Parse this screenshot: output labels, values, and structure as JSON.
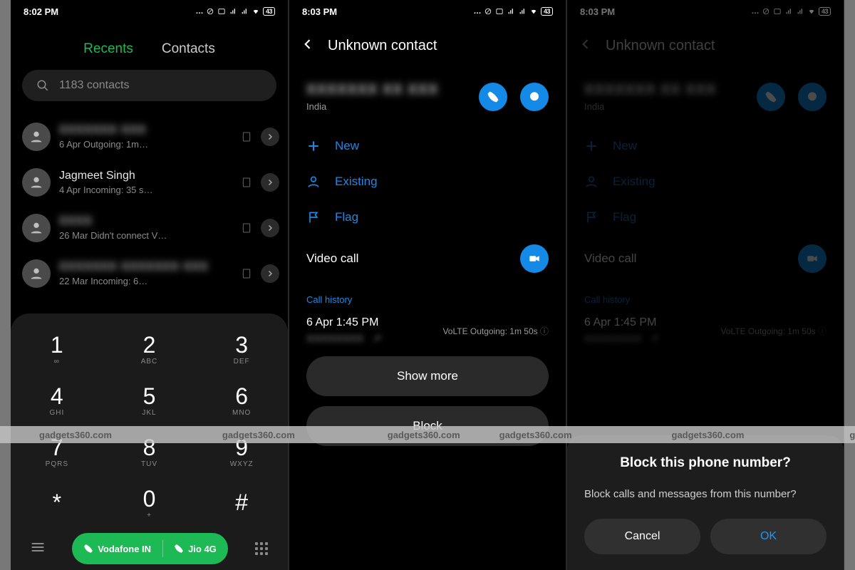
{
  "status": {
    "t1": "8:02 PM",
    "t2": "8:03 PM",
    "t3": "8:03 PM",
    "battery": "43"
  },
  "s1": {
    "tabs": {
      "recents": "Recents",
      "contacts": "Contacts"
    },
    "search": "1183 contacts",
    "rows": [
      {
        "name": "",
        "info": "6 Apr Outgoing: 1m…"
      },
      {
        "name": "Jagmeet Singh",
        "info": "4 Apr Incoming: 35 s…"
      },
      {
        "name": "",
        "info": "26 Mar Didn't connect V…"
      },
      {
        "name": "",
        "info": "22 Mar Incoming: 6…"
      }
    ],
    "dial": {
      "keys": [
        {
          "d": "1",
          "l": "∞"
        },
        {
          "d": "2",
          "l": "ABC"
        },
        {
          "d": "3",
          "l": "DEF"
        },
        {
          "d": "4",
          "l": "GHI"
        },
        {
          "d": "5",
          "l": "JKL"
        },
        {
          "d": "6",
          "l": "MNO"
        },
        {
          "d": "7",
          "l": "PQRS"
        },
        {
          "d": "8",
          "l": "TUV"
        },
        {
          "d": "9",
          "l": "WXYZ"
        },
        {
          "d": "*",
          "l": ""
        },
        {
          "d": "0",
          "l": "+"
        },
        {
          "d": "#",
          "l": ""
        }
      ],
      "sim1": "Vodafone IN",
      "sim2": "Jio 4G"
    }
  },
  "contact": {
    "title": "Unknown contact",
    "country": "India",
    "actions": {
      "new": "New",
      "existing": "Existing",
      "flag": "Flag"
    },
    "video": "Video call",
    "historyTitle": "Call history",
    "histTime": "6 Apr 1:45 PM",
    "histMeta": "VoLTE  Outgoing: 1m 50s",
    "showMore": "Show more",
    "block": "Block"
  },
  "dialog": {
    "title": "Block this phone number?",
    "body": "Block calls and messages from this number?",
    "cancel": "Cancel",
    "ok": "OK"
  },
  "watermark": "gadgets360.com"
}
